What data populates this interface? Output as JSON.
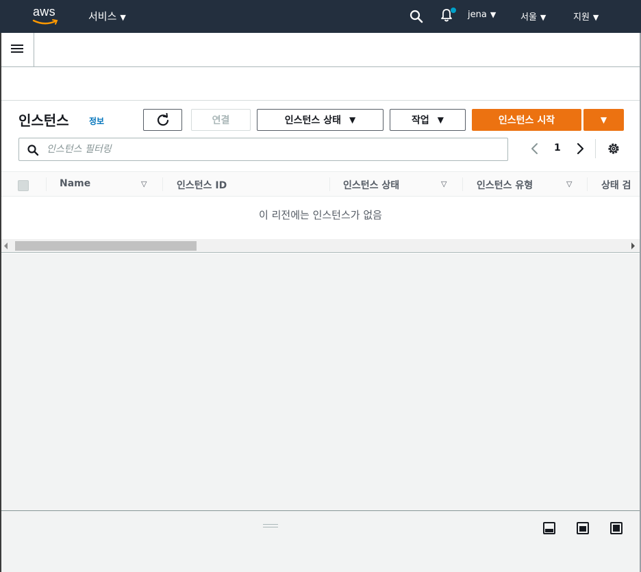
{
  "nav": {
    "logo": "aws",
    "services_label": "서비스",
    "user_label": "jena",
    "region_label": "서울",
    "support_label": "지원",
    "caret": "▼",
    "bell_badge_color": "#00a1c9"
  },
  "panel": {
    "title": "인스턴스",
    "info_link": "정보",
    "connect_button": "연결",
    "instance_state_button": "인스턴스 상태",
    "actions_button": "작업",
    "launch_button": "인스턴스 시작",
    "launch_color": "#ec7211",
    "caret": "▼"
  },
  "filter": {
    "placeholder": "인스턴스 필터링"
  },
  "pagination": {
    "current_page": "1"
  },
  "table": {
    "columns": [
      {
        "label": "Name",
        "sortable": true
      },
      {
        "label": "인스턴스 ID",
        "sortable": false
      },
      {
        "label": "인스턴스 상태",
        "sortable": true
      },
      {
        "label": "인스턴스 유형",
        "sortable": true
      },
      {
        "label": "상태 검",
        "sortable": false
      }
    ],
    "sort_icon": "▽",
    "empty_message": "이 리전에는 인스턴스가 없음"
  }
}
